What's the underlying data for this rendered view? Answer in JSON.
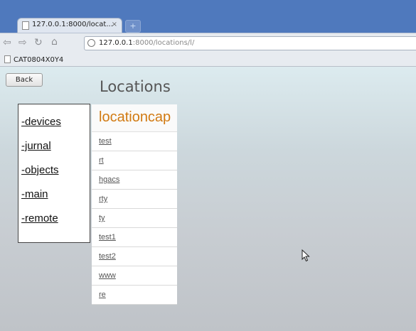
{
  "browser": {
    "tab_title": "127.0.0.1:8000/locat...",
    "tab_close": "×",
    "new_tab": "+",
    "url_host": "127.0.0.1",
    "url_rest": ":8000/locations/l/",
    "bookmark": "CAT0804X0Y4",
    "nav_icons": [
      "back-icon",
      "forward-icon",
      "reload-icon",
      "home-icon"
    ]
  },
  "page": {
    "back_label": "Back",
    "title": "Locations",
    "menu": [
      "-devices",
      "-jurnal",
      "-objects",
      "-main",
      "-remote"
    ],
    "list_header": "locationcap",
    "locations": [
      "test",
      "rt",
      "hgacs",
      "rty",
      "ty",
      "test1",
      "test2",
      "www",
      "re"
    ]
  },
  "colors": {
    "titlebar": "#4f79bd",
    "list_header": "#d17a12"
  }
}
